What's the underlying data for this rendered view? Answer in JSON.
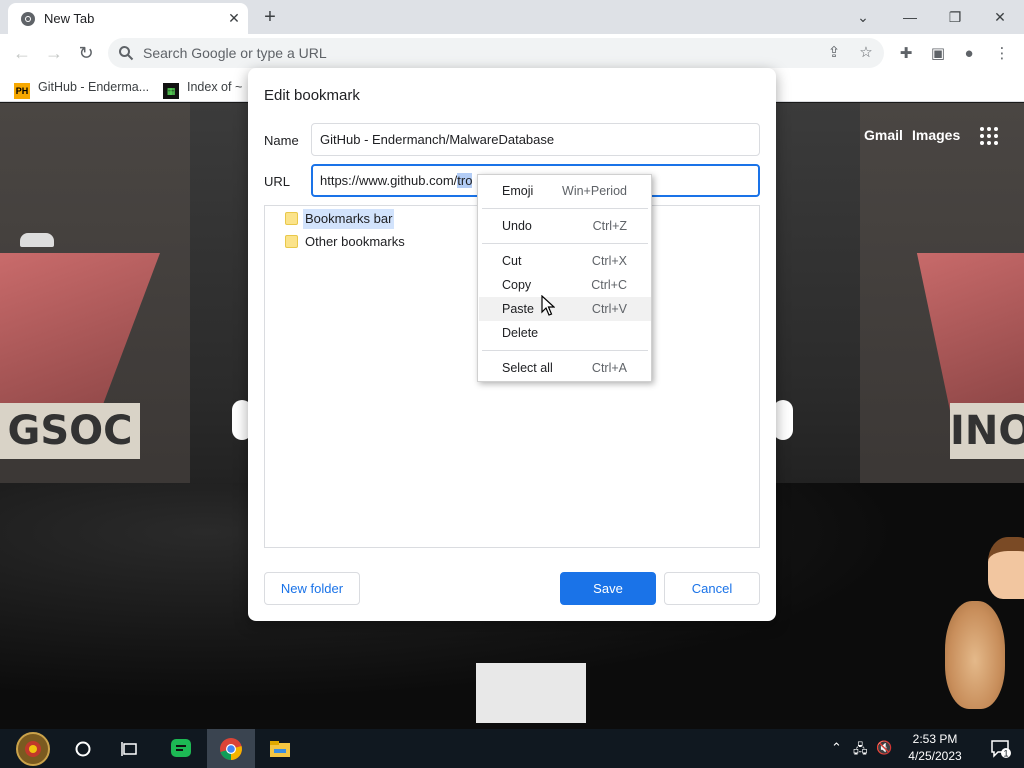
{
  "browser": {
    "tab_title": "New Tab",
    "tab_close": "✕",
    "new_tab": "+",
    "window_controls": {
      "tab_search": "⌄",
      "minimize": "—",
      "restore": "❐",
      "close": "✕"
    },
    "omnibox_placeholder": "Search Google or type a URL",
    "bookmarks": [
      {
        "label": "GitHub - Enderma...",
        "icon_text": "PH"
      },
      {
        "label": "Index of ~",
        "icon_text": "▦"
      }
    ]
  },
  "ntp": {
    "gmail": "Gmail",
    "images": "Images",
    "sign_left": "GSOC",
    "sign_right": "INO"
  },
  "dialog": {
    "title": "Edit bookmark",
    "name_label": "Name",
    "name_value": "GitHub - Endermanch/MalwareDatabase",
    "url_label": "URL",
    "url_value_prefix": "https://www.github.com/",
    "url_value_selected": "tro",
    "folders": [
      "Bookmarks bar",
      "Other bookmarks"
    ],
    "new_folder": "New folder",
    "save": "Save",
    "cancel": "Cancel"
  },
  "context_menu": [
    {
      "label": "Emoji",
      "shortcut": "Win+Period"
    },
    {
      "label": "Undo",
      "shortcut": "Ctrl+Z"
    },
    {
      "label": "Cut",
      "shortcut": "Ctrl+X"
    },
    {
      "label": "Copy",
      "shortcut": "Ctrl+C"
    },
    {
      "label": "Paste",
      "shortcut": "Ctrl+V",
      "hovered": true
    },
    {
      "label": "Delete",
      "shortcut": ""
    },
    {
      "label": "Select all",
      "shortcut": "Ctrl+A"
    }
  ],
  "taskbar": {
    "time": "2:53 PM",
    "date": "4/25/2023",
    "notification_count": "1"
  },
  "colors": {
    "accent": "#1a73e8",
    "chrome_bg": "#dee1e6",
    "taskbar": "#101820"
  },
  "icons": [
    "chrome-icon",
    "search-icon",
    "share-icon",
    "star-icon",
    "extensions-icon",
    "sidepanel-icon",
    "profile-icon",
    "menu-icon",
    "folder-icon",
    "apps-icon"
  ]
}
